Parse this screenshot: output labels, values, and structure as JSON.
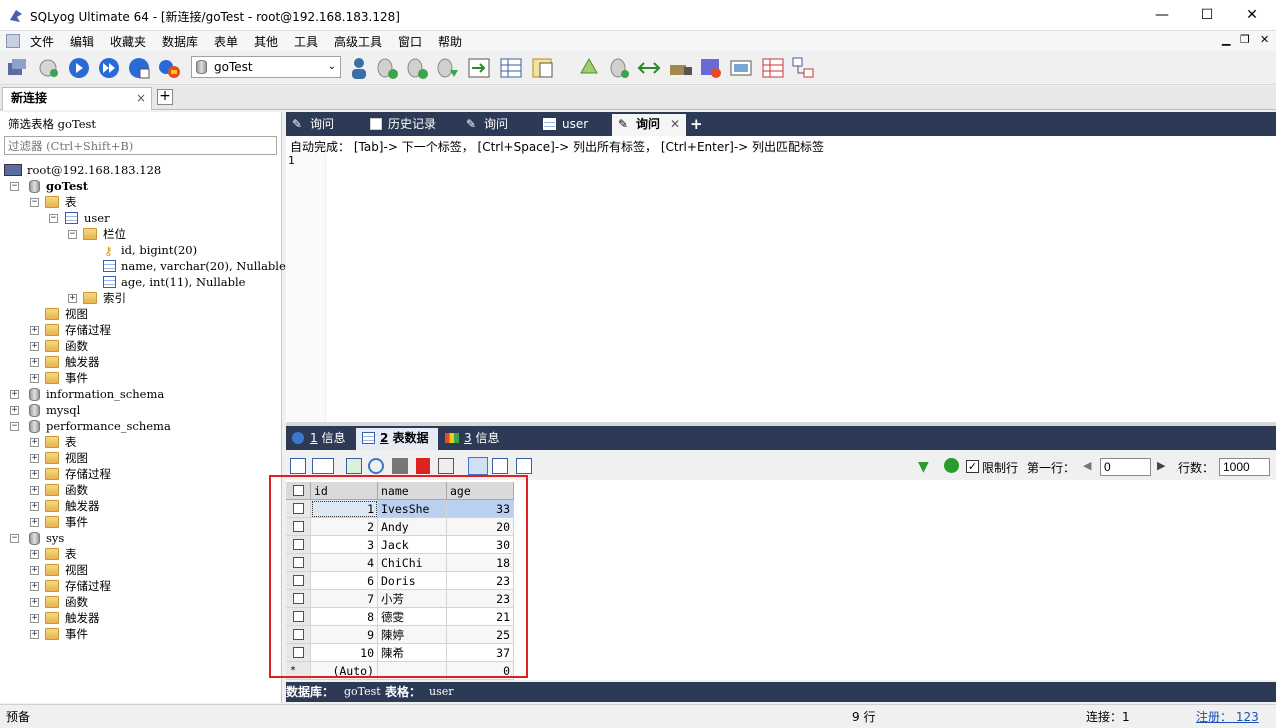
{
  "window": {
    "title": "SQLyog Ultimate 64 - [新连接/goTest - root@192.168.183.128]",
    "minimize": "—",
    "maximize": "☐",
    "close": "✕"
  },
  "menu": [
    "文件",
    "编辑",
    "收藏夹",
    "数据库",
    "表单",
    "其他",
    "工具",
    "高级工具",
    "窗口",
    "帮助"
  ],
  "toolbar": {
    "db_selected": "goTest"
  },
  "connection_tab": {
    "label": "新连接",
    "close": "×",
    "add": "+"
  },
  "left": {
    "filter_label": "筛选表格 goTest",
    "filter_placeholder": "过滤器 (Ctrl+Shift+B)",
    "tree": {
      "server": "root@192.168.183.128",
      "db_gotest": "goTest",
      "tables": "表",
      "table_user": "user",
      "columns": "栏位",
      "col1": "id, bigint(20)",
      "col2": "name, varchar(20), Nullable",
      "col3": "age, int(11), Nullable",
      "indexes": "索引",
      "views": "视图",
      "procs": "存储过程",
      "funcs": "函数",
      "triggers": "触发器",
      "events": "事件",
      "db_info": "information_schema",
      "db_mysql": "mysql",
      "db_perf": "performance_schema",
      "db_sys": "sys"
    }
  },
  "query_tabs": [
    "询问",
    "历史记录",
    "询问",
    "user",
    "询问"
  ],
  "editor": {
    "hint": "自动完成： [Tab]-> 下一个标签， [Ctrl+Space]-> 列出所有标签， [Ctrl+Enter]-> 列出匹配标签",
    "line1": "1"
  },
  "result_tabs": [
    {
      "num": "1",
      "label": "信息"
    },
    {
      "num": "2",
      "label": "表数据"
    },
    {
      "num": "3",
      "label": "信息"
    }
  ],
  "result_toolbar": {
    "limit_label": "限制行",
    "first_row_label": "第一行：",
    "first_row_value": "0",
    "rows_label": "行数：",
    "rows_value": "1000"
  },
  "grid": {
    "columns": [
      "id",
      "name",
      "age"
    ],
    "rows": [
      [
        "1",
        "IvesShe",
        "33"
      ],
      [
        "2",
        "Andy",
        "20"
      ],
      [
        "3",
        "Jack",
        "30"
      ],
      [
        "4",
        "ChiChi",
        "18"
      ],
      [
        "6",
        "Doris",
        "23"
      ],
      [
        "7",
        "小芳",
        "23"
      ],
      [
        "8",
        "德雯",
        "21"
      ],
      [
        "9",
        "陳婷",
        "25"
      ],
      [
        "10",
        "陳希",
        "37"
      ]
    ],
    "new_row": [
      "(Auto)",
      "",
      "0"
    ],
    "new_row_marker": "*"
  },
  "infobar": {
    "db_label": "数据库：",
    "db_value": "goTest",
    "table_label": "表格：",
    "table_value": "user"
  },
  "status": {
    "left": "预备",
    "rows": "9 行",
    "conn": "连接：1",
    "register": "注册： 123"
  }
}
